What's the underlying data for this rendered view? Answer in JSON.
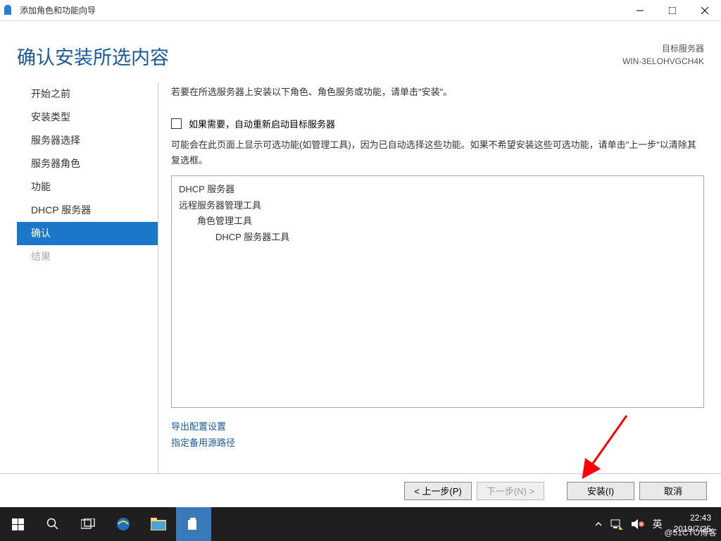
{
  "window": {
    "title": "添加角色和功能向导"
  },
  "header": {
    "title": "确认安装所选内容",
    "target_label": "目标服务器",
    "target_name": "WIN-3ELOHVGCH4K"
  },
  "sidebar": {
    "items": [
      {
        "label": "开始之前",
        "state": "normal"
      },
      {
        "label": "安装类型",
        "state": "normal"
      },
      {
        "label": "服务器选择",
        "state": "normal"
      },
      {
        "label": "服务器角色",
        "state": "normal"
      },
      {
        "label": "功能",
        "state": "normal"
      },
      {
        "label": "DHCP 服务器",
        "state": "normal"
      },
      {
        "label": "确认",
        "state": "active"
      },
      {
        "label": "结果",
        "state": "disabled"
      }
    ]
  },
  "detail": {
    "intro": "若要在所选服务器上安装以下角色、角色服务或功能，请单击\"安装\"。",
    "checkbox_label": "如果需要，自动重新启动目标服务器",
    "note": "可能会在此页面上显示可选功能(如管理工具)，因为已自动选择这些功能。如果不希望安装这些可选功能，请单击\"上一步\"以清除其复选框。",
    "features": {
      "l0a": "DHCP 服务器",
      "l0b": "远程服务器管理工具",
      "l1a": "角色管理工具",
      "l2a": "DHCP 服务器工具"
    },
    "link_export": "导出配置设置",
    "link_altsrc": "指定备用源路径"
  },
  "buttons": {
    "prev": "< 上一步(P)",
    "next": "下一步(N) >",
    "install": "安装(I)",
    "cancel": "取消"
  },
  "taskbar": {
    "ime": "英",
    "time": "22:43",
    "date": "2019/7/25",
    "watermark": "@51CTO博客"
  }
}
